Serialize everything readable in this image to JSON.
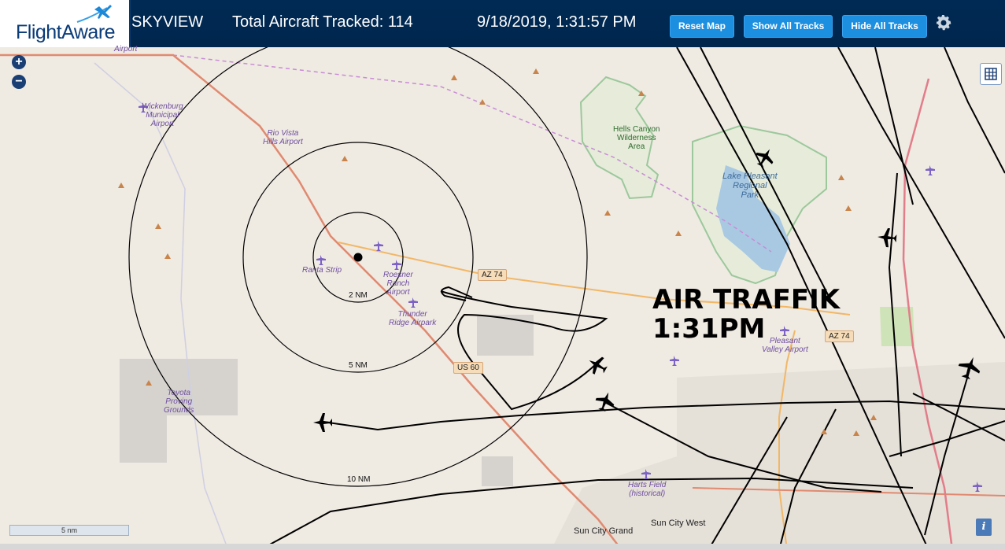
{
  "header": {
    "logo_text": "FlightAware",
    "app_name": "SKYVIEW",
    "total_aircraft_label": "Total Aircraft Tracked: 114",
    "datetime": "9/18/2019, 1:31:57 PM",
    "buttons": {
      "reset": "Reset Map",
      "show_all": "Show All Tracks",
      "hide_all": "Hide All Tracks"
    },
    "settings_icon": "gear-icon"
  },
  "map": {
    "overlay_title": "AIR TRAFFIK",
    "overlay_time": "1:31PM",
    "zoom_in": "+",
    "zoom_out": "−",
    "scale": "5 nm",
    "info": "i",
    "range_rings": [
      "2 NM",
      "5 NM",
      "10 NM"
    ],
    "airports": {
      "top_cut": "Airport",
      "wickenburg": [
        "Wickenburg",
        "Municipal",
        "Airport"
      ],
      "rio_vista": [
        "Rio Vista",
        "Hills Airport"
      ],
      "ranta": "Ranta Strip",
      "roesner": [
        "Roesner",
        "Ranch",
        "Airport"
      ],
      "thunder": [
        "Thunder",
        "Ridge Airpark"
      ],
      "pleasant": [
        "Pleasant",
        "Valley Airport"
      ],
      "harts": [
        "Harts Field",
        "(historical)"
      ]
    },
    "areas": {
      "hells_canyon": [
        "Hells Canyon",
        "Wilderness",
        "Area"
      ],
      "lake": [
        "Lake Pleasant",
        "Regional",
        "Park"
      ],
      "toyota": [
        "Toyota",
        "Proving",
        "Grounds"
      ]
    },
    "roads": {
      "az74_a": "AZ 74",
      "az74_b": "AZ 74",
      "us60": "US 60"
    },
    "towns": {
      "sun_city_west": "Sun City West",
      "sun_city_grand": "Sun City Grand"
    }
  },
  "colors": {
    "header_bg": "#002a54",
    "button_bg": "#1c8fe0",
    "map_bg": "#efeae2"
  }
}
